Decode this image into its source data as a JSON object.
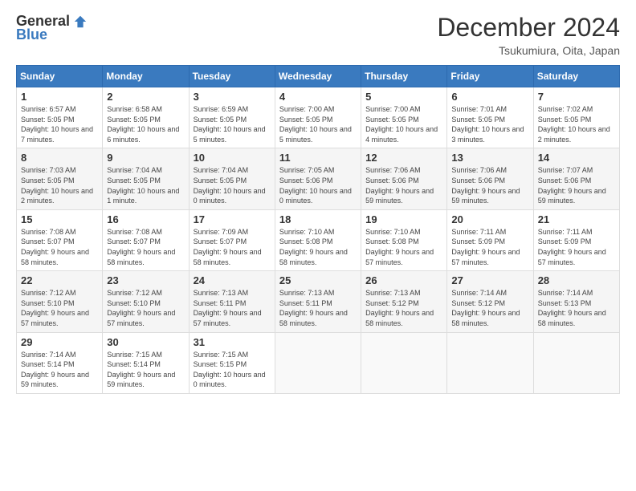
{
  "header": {
    "logo_general": "General",
    "logo_blue": "Blue",
    "month_title": "December 2024",
    "location": "Tsukumiura, Oita, Japan"
  },
  "calendar": {
    "days_of_week": [
      "Sunday",
      "Monday",
      "Tuesday",
      "Wednesday",
      "Thursday",
      "Friday",
      "Saturday"
    ],
    "weeks": [
      [
        {
          "day": "",
          "info": ""
        },
        {
          "day": "2",
          "info": "Sunrise: 6:58 AM\nSunset: 5:05 PM\nDaylight: 10 hours and 6 minutes."
        },
        {
          "day": "3",
          "info": "Sunrise: 6:59 AM\nSunset: 5:05 PM\nDaylight: 10 hours and 5 minutes."
        },
        {
          "day": "4",
          "info": "Sunrise: 7:00 AM\nSunset: 5:05 PM\nDaylight: 10 hours and 5 minutes."
        },
        {
          "day": "5",
          "info": "Sunrise: 7:00 AM\nSunset: 5:05 PM\nDaylight: 10 hours and 4 minutes."
        },
        {
          "day": "6",
          "info": "Sunrise: 7:01 AM\nSunset: 5:05 PM\nDaylight: 10 hours and 3 minutes."
        },
        {
          "day": "7",
          "info": "Sunrise: 7:02 AM\nSunset: 5:05 PM\nDaylight: 10 hours and 2 minutes."
        }
      ],
      [
        {
          "day": "8",
          "info": "Sunrise: 7:03 AM\nSunset: 5:05 PM\nDaylight: 10 hours and 2 minutes."
        },
        {
          "day": "9",
          "info": "Sunrise: 7:04 AM\nSunset: 5:05 PM\nDaylight: 10 hours and 1 minute."
        },
        {
          "day": "10",
          "info": "Sunrise: 7:04 AM\nSunset: 5:05 PM\nDaylight: 10 hours and 0 minutes."
        },
        {
          "day": "11",
          "info": "Sunrise: 7:05 AM\nSunset: 5:06 PM\nDaylight: 10 hours and 0 minutes."
        },
        {
          "day": "12",
          "info": "Sunrise: 7:06 AM\nSunset: 5:06 PM\nDaylight: 9 hours and 59 minutes."
        },
        {
          "day": "13",
          "info": "Sunrise: 7:06 AM\nSunset: 5:06 PM\nDaylight: 9 hours and 59 minutes."
        },
        {
          "day": "14",
          "info": "Sunrise: 7:07 AM\nSunset: 5:06 PM\nDaylight: 9 hours and 59 minutes."
        }
      ],
      [
        {
          "day": "15",
          "info": "Sunrise: 7:08 AM\nSunset: 5:07 PM\nDaylight: 9 hours and 58 minutes."
        },
        {
          "day": "16",
          "info": "Sunrise: 7:08 AM\nSunset: 5:07 PM\nDaylight: 9 hours and 58 minutes."
        },
        {
          "day": "17",
          "info": "Sunrise: 7:09 AM\nSunset: 5:07 PM\nDaylight: 9 hours and 58 minutes."
        },
        {
          "day": "18",
          "info": "Sunrise: 7:10 AM\nSunset: 5:08 PM\nDaylight: 9 hours and 58 minutes."
        },
        {
          "day": "19",
          "info": "Sunrise: 7:10 AM\nSunset: 5:08 PM\nDaylight: 9 hours and 57 minutes."
        },
        {
          "day": "20",
          "info": "Sunrise: 7:11 AM\nSunset: 5:09 PM\nDaylight: 9 hours and 57 minutes."
        },
        {
          "day": "21",
          "info": "Sunrise: 7:11 AM\nSunset: 5:09 PM\nDaylight: 9 hours and 57 minutes."
        }
      ],
      [
        {
          "day": "22",
          "info": "Sunrise: 7:12 AM\nSunset: 5:10 PM\nDaylight: 9 hours and 57 minutes."
        },
        {
          "day": "23",
          "info": "Sunrise: 7:12 AM\nSunset: 5:10 PM\nDaylight: 9 hours and 57 minutes."
        },
        {
          "day": "24",
          "info": "Sunrise: 7:13 AM\nSunset: 5:11 PM\nDaylight: 9 hours and 57 minutes."
        },
        {
          "day": "25",
          "info": "Sunrise: 7:13 AM\nSunset: 5:11 PM\nDaylight: 9 hours and 58 minutes."
        },
        {
          "day": "26",
          "info": "Sunrise: 7:13 AM\nSunset: 5:12 PM\nDaylight: 9 hours and 58 minutes."
        },
        {
          "day": "27",
          "info": "Sunrise: 7:14 AM\nSunset: 5:12 PM\nDaylight: 9 hours and 58 minutes."
        },
        {
          "day": "28",
          "info": "Sunrise: 7:14 AM\nSunset: 5:13 PM\nDaylight: 9 hours and 58 minutes."
        }
      ],
      [
        {
          "day": "29",
          "info": "Sunrise: 7:14 AM\nSunset: 5:14 PM\nDaylight: 9 hours and 59 minutes."
        },
        {
          "day": "30",
          "info": "Sunrise: 7:15 AM\nSunset: 5:14 PM\nDaylight: 9 hours and 59 minutes."
        },
        {
          "day": "31",
          "info": "Sunrise: 7:15 AM\nSunset: 5:15 PM\nDaylight: 10 hours and 0 minutes."
        },
        {
          "day": "",
          "info": ""
        },
        {
          "day": "",
          "info": ""
        },
        {
          "day": "",
          "info": ""
        },
        {
          "day": "",
          "info": ""
        }
      ]
    ],
    "week1_day1": {
      "day": "1",
      "info": "Sunrise: 6:57 AM\nSunset: 5:05 PM\nDaylight: 10 hours and 7 minutes."
    }
  }
}
